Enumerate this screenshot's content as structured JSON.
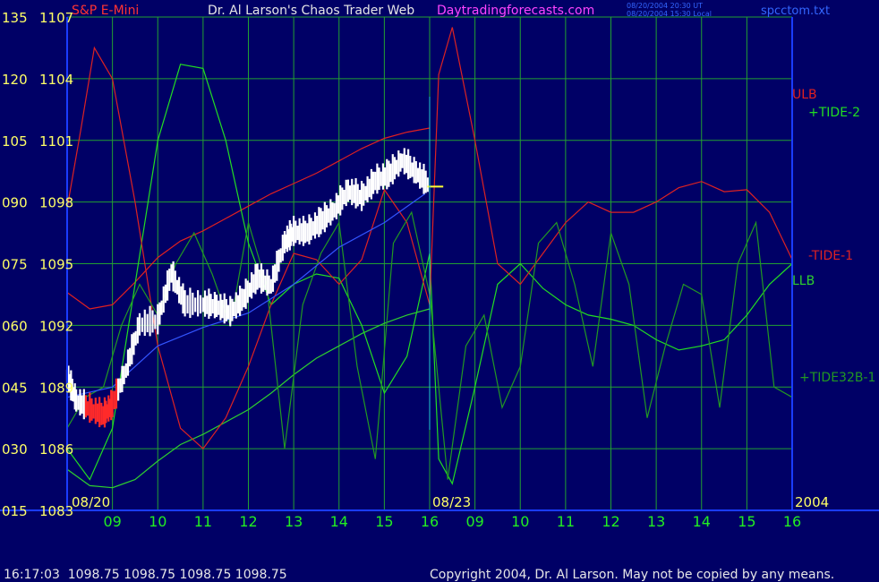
{
  "header": {
    "symbol": "S&P E-Mini",
    "title": "Dr. Al Larson's Chaos Trader Web",
    "site": "Daytradingforecasts.com",
    "ut_time": "08/20/2004 20:30 UT",
    "local_time": "08/20/2004 15:30 Local",
    "file": "spcctom.txt"
  },
  "footer": {
    "quote": "16:17:03  1098.75 1098.75 1098.75 1098.75",
    "copyright": "Copyright 2004, Dr. Al Larson. May not be copied by any means."
  },
  "colors": {
    "background": "#000066",
    "frame": "#1a3cff",
    "grid": "#22a032",
    "price_bar": "#ffffff",
    "price_down_bar": "#ff2a2a",
    "price_last": "#ffff33",
    "ulb": "#e02020",
    "llb": "#2ed02e",
    "tide2": "#22dd22",
    "tide1": "#dd2222",
    "tide32b": "#229922",
    "blue_avg": "#3355ff",
    "label_yellow": "#ffff66",
    "label_green": "#22ee22",
    "header_white": "#e6e6e6",
    "header_magenta": "#ff44ff"
  },
  "chart_data": {
    "type": "line",
    "title": "Dr. Al Larson's Chaos Trader Web",
    "xlabel": "",
    "ylabel": "",
    "grid": true,
    "left_scale_ticks": [
      "135",
      "120",
      "105",
      "090",
      "075",
      "060",
      "045",
      "030",
      "015"
    ],
    "price_axis": {
      "ticks": [
        "1107",
        "1104",
        "1101",
        "1098",
        "1095",
        "1092",
        "1089",
        "1086",
        "1083"
      ],
      "ylim": [
        1083,
        1107
      ]
    },
    "x_ticks": [
      "09",
      "10",
      "11",
      "12",
      "13",
      "14",
      "15",
      "16",
      "09",
      "10",
      "11",
      "12",
      "13",
      "14",
      "15",
      "16"
    ],
    "date_labels": [
      "08/20",
      "08/23",
      "2004"
    ],
    "series_labels": [
      {
        "name": "ULB",
        "color": "#e02020"
      },
      {
        "name": "+TIDE-2",
        "color": "#22dd22"
      },
      {
        "name": "-TIDE-1",
        "color": "#dd2222"
      },
      {
        "name": "LLB",
        "color": "#2ed02e"
      },
      {
        "name": "+TIDE32B-1",
        "color": "#229922"
      }
    ],
    "series": [
      {
        "name": "ULB",
        "x": [
          8.0,
          8.5,
          9.0,
          9.5,
          10.0,
          10.5,
          11.0,
          11.5,
          12.0,
          12.5,
          13.0,
          13.5,
          14.0,
          14.5,
          15.0,
          15.5,
          16.0
        ],
        "y": [
          1093.6,
          1092.8,
          1093.0,
          1094.1,
          1095.3,
          1096.1,
          1096.6,
          1097.2,
          1097.8,
          1098.4,
          1098.9,
          1099.4,
          1100.0,
          1100.6,
          1101.1,
          1101.4,
          1101.6
        ]
      },
      {
        "name": "LLB",
        "x": [
          8.0,
          8.5,
          9.0,
          9.5,
          10.0,
          10.5,
          11.0,
          11.5,
          12.0,
          12.5,
          13.0,
          13.5,
          14.0,
          14.5,
          15.0,
          15.5,
          16.0
        ],
        "y": [
          1085.0,
          1084.2,
          1084.1,
          1084.5,
          1085.4,
          1086.2,
          1086.7,
          1087.3,
          1087.9,
          1088.7,
          1089.6,
          1090.4,
          1091.0,
          1091.6,
          1092.1,
          1092.5,
          1092.8
        ]
      },
      {
        "name": "+TIDE-2",
        "x": [
          8.0,
          8.5,
          9.0,
          9.5,
          10.0,
          10.5,
          11.0,
          11.5,
          12.0,
          12.5,
          13.0,
          13.5,
          14.0,
          14.5,
          15.0,
          15.5,
          16.0,
          16.2,
          16.5,
          17.0,
          17.5,
          18.0,
          18.5,
          19.0,
          19.5,
          20.0,
          20.5,
          21.0,
          21.5,
          22.0,
          22.5,
          23.0,
          23.5,
          24.0
        ],
        "y": [
          1086.0,
          1084.5,
          1087.0,
          1094.0,
          1101.0,
          1104.7,
          1104.5,
          1101.0,
          1096.0,
          1093.0,
          1094.0,
          1094.5,
          1094.3,
          1092.0,
          1088.7,
          1090.5,
          1095.5,
          1085.5,
          1084.3,
          1089.0,
          1094.0,
          1095.0,
          1093.8,
          1093.0,
          1092.5,
          1092.3,
          1092.0,
          1091.3,
          1090.8,
          1091.0,
          1091.3,
          1092.5,
          1094.0,
          1095.0
        ]
      },
      {
        "name": "-TIDE-1",
        "x": [
          8.0,
          8.3,
          8.6,
          9.0,
          9.5,
          10.0,
          10.5,
          11.0,
          11.5,
          12.0,
          12.5,
          13.0,
          13.5,
          14.0,
          14.5,
          15.0,
          15.5,
          16.0,
          16.2,
          16.5,
          17.0,
          17.5,
          18.0,
          18.5,
          19.0,
          19.5,
          20.0,
          20.5,
          21.0,
          21.5,
          22.0,
          22.5,
          23.0,
          23.5,
          24.0
        ],
        "y": [
          1097.7,
          1101.5,
          1105.5,
          1104.0,
          1098.0,
          1091.0,
          1087.0,
          1086.0,
          1087.5,
          1090.0,
          1093.0,
          1095.5,
          1095.2,
          1094.0,
          1095.2,
          1098.6,
          1097.0,
          1093.0,
          1104.2,
          1106.5,
          1101.0,
          1095.0,
          1094.0,
          1095.5,
          1097.0,
          1098.0,
          1097.5,
          1097.5,
          1098.0,
          1098.7,
          1099.0,
          1098.5,
          1098.6,
          1097.5,
          1095.2
        ]
      },
      {
        "name": "+TIDE32B-1",
        "x": [
          8.0,
          8.4,
          8.8,
          9.2,
          9.6,
          10.0,
          10.4,
          10.8,
          11.2,
          11.6,
          12.0,
          12.4,
          12.8,
          13.2,
          13.6,
          14.0,
          14.4,
          14.8,
          15.2,
          15.6,
          16.0,
          16.4,
          16.8,
          17.2,
          17.6,
          18.0,
          18.4,
          18.8,
          19.2,
          19.6,
          20.0,
          20.4,
          20.8,
          21.2,
          21.6,
          22.0,
          22.4,
          22.8,
          23.2,
          23.6,
          24.0
        ],
        "y": [
          1087.0,
          1088.5,
          1089.0,
          1092.0,
          1094.0,
          1092.5,
          1095.0,
          1096.5,
          1094.5,
          1092.0,
          1097.0,
          1094.0,
          1086.0,
          1093.0,
          1095.5,
          1097.0,
          1090.0,
          1085.5,
          1096.0,
          1097.5,
          1093.5,
          1084.5,
          1091.0,
          1092.5,
          1088.0,
          1090.0,
          1096.0,
          1097.0,
          1094.0,
          1090.0,
          1096.5,
          1094.0,
          1087.5,
          1091.0,
          1094.0,
          1093.5,
          1088.0,
          1095.0,
          1097.0,
          1089.0,
          1088.5
        ]
      },
      {
        "name": "blue-avg",
        "x": [
          8.0,
          9.0,
          10.0,
          11.0,
          12.0,
          13.0,
          14.0,
          15.0,
          15.9
        ],
        "y": [
          1088.5,
          1089.0,
          1091.0,
          1091.9,
          1092.6,
          1094.0,
          1095.8,
          1097.0,
          1098.4
        ]
      },
      {
        "name": "price",
        "x": [
          8.0,
          8.2,
          8.5,
          8.8,
          9.0,
          9.3,
          9.6,
          10.0,
          10.3,
          10.6,
          11.0,
          11.3,
          11.6,
          11.9,
          12.2,
          12.5,
          12.8,
          13.0,
          13.3,
          13.6,
          13.9,
          14.2,
          14.5,
          14.8,
          15.1,
          15.4,
          15.7,
          16.0
        ],
        "y": [
          1089.5,
          1088.3,
          1087.9,
          1087.6,
          1088.1,
          1089.8,
          1092.0,
          1092.2,
          1094.5,
          1093.0,
          1093.0,
          1092.9,
          1092.6,
          1093.3,
          1094.3,
          1093.9,
          1096.0,
          1096.5,
          1096.5,
          1097.0,
          1097.6,
          1098.5,
          1098.2,
          1099.0,
          1099.3,
          1100.0,
          1099.4,
          1098.75
        ]
      }
    ]
  }
}
